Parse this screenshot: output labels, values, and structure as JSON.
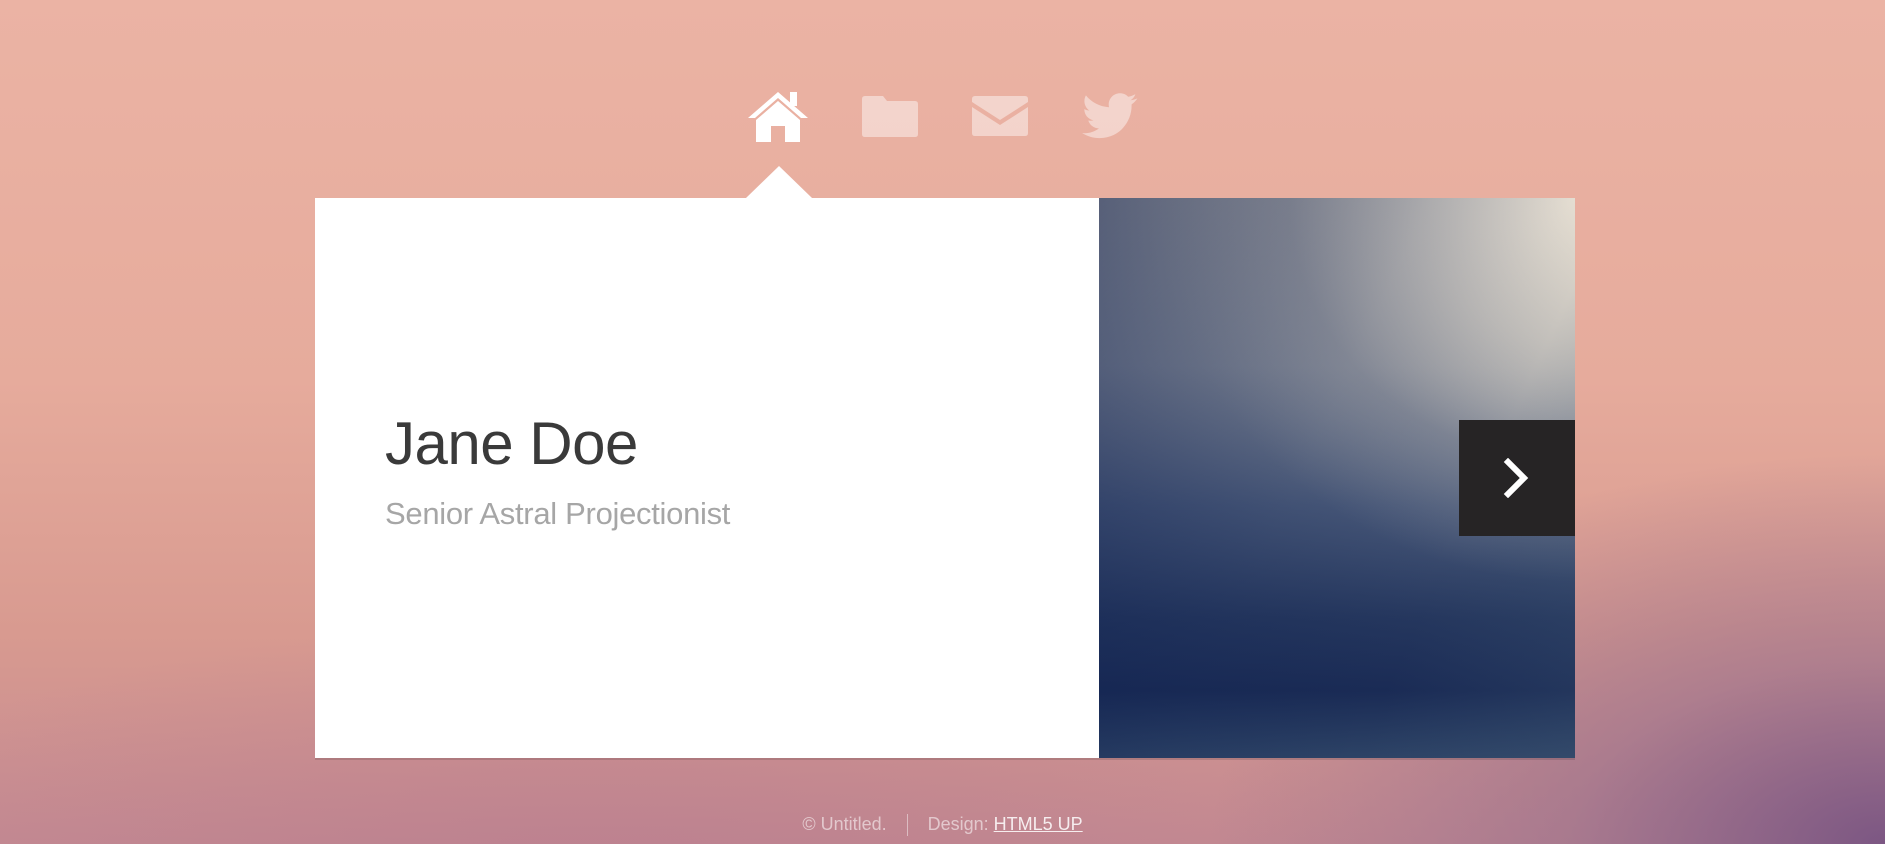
{
  "nav": {
    "items": [
      {
        "icon": "home-icon",
        "active": true
      },
      {
        "icon": "folder-icon",
        "active": false
      },
      {
        "icon": "mail-icon",
        "active": false
      },
      {
        "icon": "twitter-icon",
        "active": false
      }
    ]
  },
  "profile": {
    "name": "Jane Doe",
    "title": "Senior Astral Projectionist"
  },
  "photo": {
    "next_icon": "chevron-right-icon"
  },
  "footer": {
    "copyright": "© Untitled.",
    "design_label": "Design:",
    "design_link": "HTML5 UP"
  },
  "colors": {
    "panel": "#ffffff",
    "name_text": "#3a3a3a",
    "subtitle_text": "#a6a6a6",
    "next_button_bg": "#262425"
  }
}
